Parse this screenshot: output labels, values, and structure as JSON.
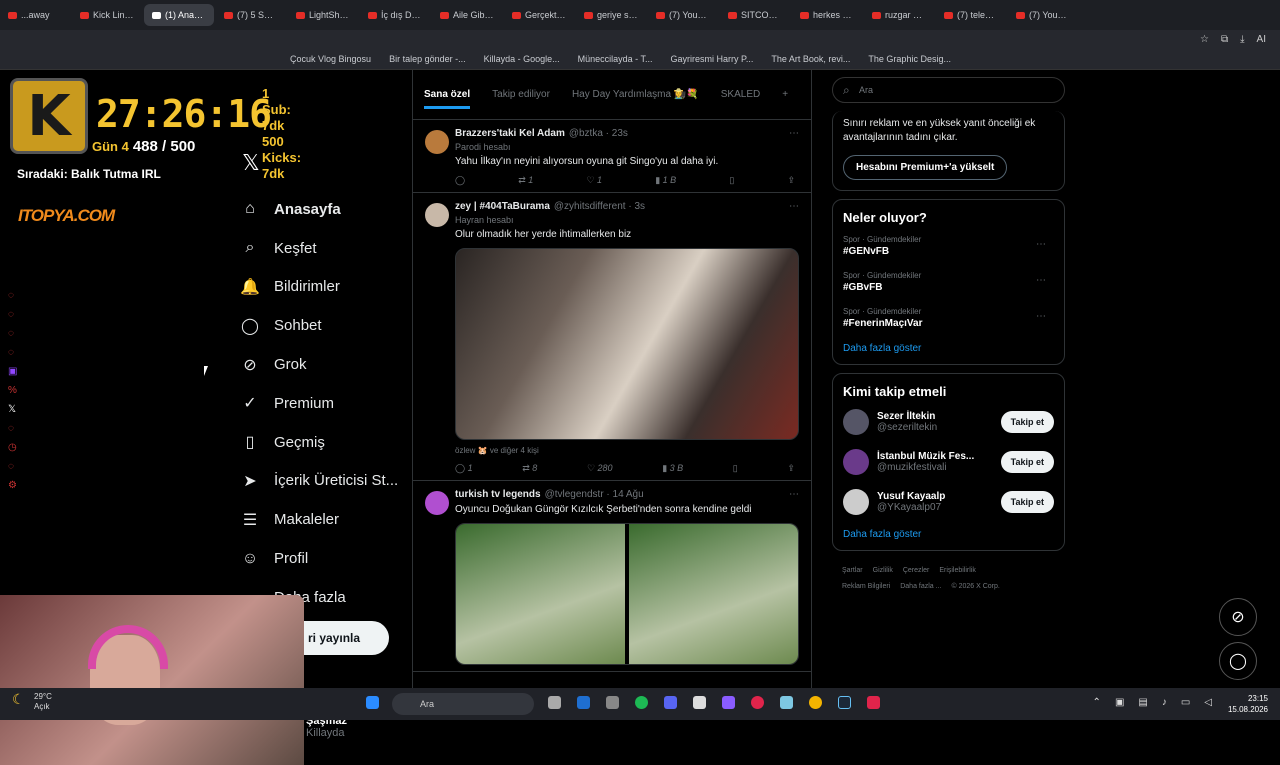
{
  "browser": {
    "tabs": [
      {
        "label": "...away",
        "type": "yt"
      },
      {
        "label": "Kick Link Cr",
        "type": "yt"
      },
      {
        "label": "(1) Anasayfa / X",
        "type": "x",
        "active": true
      },
      {
        "label": "(7) 5 Saniye",
        "type": "yt"
      },
      {
        "label": "LightShot la",
        "type": "other"
      },
      {
        "label": "İç dış DUVA",
        "type": "yt"
      },
      {
        "label": "Aile Gibi Bir",
        "type": "yt"
      },
      {
        "label": "Gerçekten",
        "type": "yt"
      },
      {
        "label": "geriye sade",
        "type": "yt"
      },
      {
        "label": "(7) YouTube",
        "type": "yt"
      },
      {
        "label": "SITCOM EV",
        "type": "yt"
      },
      {
        "label": "herkes bir a",
        "type": "yt"
      },
      {
        "label": "ruzgar nere",
        "type": "yt"
      },
      {
        "label": "(7) televole",
        "type": "yt"
      },
      {
        "label": "(7) YouTube",
        "type": "yt"
      }
    ],
    "bookmarks": [
      "Çocuk Vlog Bingosu",
      "Bir talep gönder -...",
      "Killayda - Google...",
      "Müneccilayda - T...",
      "Gayriresmi Harry P...",
      "The Art Book, revi...",
      "The Graphic Desig..."
    ],
    "ai_label": "AI"
  },
  "stream": {
    "timer": "27:26:16",
    "subs": "1 Sub: 7dk",
    "kicks": "500 Kicks: 7dk",
    "day_label": "Gün 4",
    "progress": "488 / 500",
    "next": "Sıradaki: Balık Tutma IRL",
    "sponsor": "ITOPYA.COM",
    "logo_letter": "K"
  },
  "nav": {
    "items": [
      {
        "label": "Anasayfa",
        "icon": "⌂"
      },
      {
        "label": "Keşfet",
        "icon": "⌕"
      },
      {
        "label": "Bildirimler",
        "icon": "🔔"
      },
      {
        "label": "Sohbet",
        "icon": "◯"
      },
      {
        "label": "Grok",
        "icon": "⊘"
      },
      {
        "label": "Premium",
        "icon": "✓"
      },
      {
        "label": "Geçmiş",
        "icon": "▯"
      },
      {
        "label": "İçerik Üreticisi St...",
        "icon": "➤"
      },
      {
        "label": "Makaleler",
        "icon": "☰"
      },
      {
        "label": "Profil",
        "icon": "☺"
      },
      {
        "label": "Daha fazla",
        "icon": "⋯"
      }
    ],
    "post_button": "ri yayınla",
    "profile_name": "Şaşmaz",
    "profile_handle": "Killayda"
  },
  "feed": {
    "tabs": [
      "Sana özel",
      "Takip ediliyor",
      "Hay Day Yardımlaşma 👩‍🌾💐",
      "SKALED"
    ],
    "tweets": [
      {
        "name": "Brazzers'taki Kel Adam",
        "handle": "@bztka · 23s",
        "badge": "Parodi hesabı",
        "text": "Yahu İlkay'ın neyini alıyorsun oyuna git Singo'yu al daha iyi.",
        "replies": "",
        "retweets": "1",
        "likes": "1",
        "views": "1 B"
      },
      {
        "name": "zey | #404TaBurama",
        "handle": "@zyhitsdifferent · 3s",
        "badge": "Hayran hesabı",
        "text": "Olur olmadık her yerde ihtimallerken biz",
        "liked_by": "özlew 🐹 ve diğer 4 kişi",
        "replies": "1",
        "retweets": "8",
        "likes": "280",
        "views": "3 B"
      },
      {
        "name": "turkish tv legends",
        "handle": "@tvlegendstr · 14 Ağu",
        "text": "Oyuncu Doğukan Güngör Kızılcık Şerbeti'nden sonra kendine geldi"
      }
    ]
  },
  "right": {
    "search_placeholder": "Ara",
    "premium_text": "Sınırı reklam ve en yüksek yanıt önceliği ek avantajlarının tadını çıkar.",
    "premium_button": "Hesabını Premium+'a yükselt",
    "trends_title": "Neler oluyor?",
    "trends": [
      {
        "category": "Spor · Gündemdekiler",
        "name": "#GENvFB"
      },
      {
        "category": "Spor · Gündemdekiler",
        "name": "#GBvFB"
      },
      {
        "category": "Spor · Gündemdekiler",
        "name": "#FenerinMaçıVar"
      }
    ],
    "show_more": "Daha fazla göster",
    "who_title": "Kimi takip etmeli",
    "who": [
      {
        "name": "Sezer İltekin",
        "handle": "@sezeriltekin"
      },
      {
        "name": "İstanbul Müzik Fes...",
        "handle": "@muzikfestivali"
      },
      {
        "name": "Yusuf Kayaalp",
        "handle": "@YKayaalp07"
      }
    ],
    "follow_label": "Takip et",
    "footer": [
      "Şartlar",
      "Gizlilik",
      "Çerezler",
      "Erişilebilirlik",
      "Reklam Bilgileri",
      "Daha fazla ...",
      "© 2026 X Corp."
    ]
  },
  "taskbar": {
    "temp": "29°C",
    "condition": "Açık",
    "search": "Ara",
    "time": "23:15",
    "date": "15.08.2026"
  }
}
